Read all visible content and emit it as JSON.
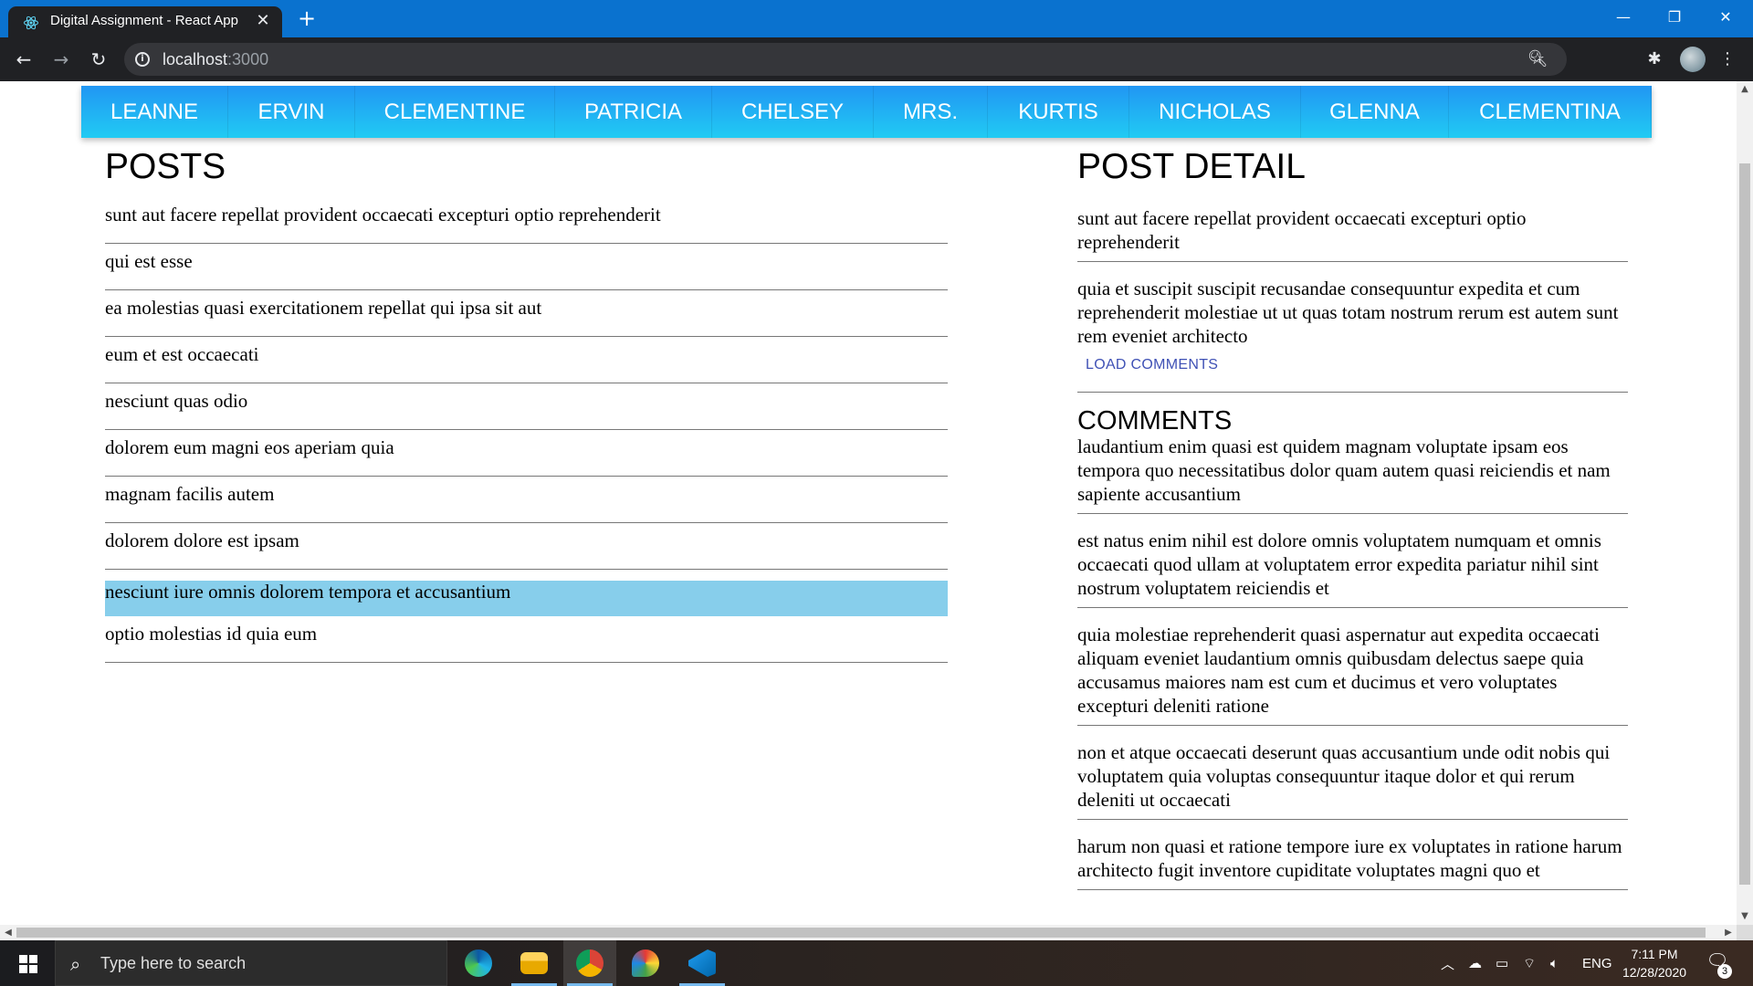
{
  "browser": {
    "tab_title": "Digital Assignment - React App",
    "tab_close": "✕",
    "new_tab": "+",
    "url_host": "localhost",
    "url_port": ":3000",
    "window_controls": {
      "minimize": "—",
      "restore": "❐",
      "close": "✕"
    }
  },
  "nav": {
    "items": [
      "LEANNE",
      "ERVIN",
      "CLEMENTINE",
      "PATRICIA",
      "CHELSEY",
      "MRS.",
      "KURTIS",
      "NICHOLAS",
      "GLENNA",
      "CLEMENTINA"
    ],
    "colors": {
      "gradient_start": "#2196f3",
      "gradient_end": "#21cbf3"
    }
  },
  "posts": {
    "title": "POSTS",
    "items": [
      "sunt aut facere repellat provident occaecati excepturi optio reprehenderit",
      "qui est esse",
      "ea molestias quasi exercitationem repellat qui ipsa sit aut",
      "eum et est occaecati",
      "nesciunt quas odio",
      "dolorem eum magni eos aperiam quia",
      "magnam facilis autem",
      "dolorem dolore est ipsam",
      "nesciunt iure omnis dolorem tempora et accusantium",
      "optio molestias id quia eum"
    ],
    "selected_index": 8,
    "selected_color": "#87ceeb"
  },
  "detail": {
    "title": "POST DETAIL",
    "post_title": "sunt aut facere repellat provident occaecati excepturi optio reprehenderit",
    "post_body": "quia et suscipit suscipit recusandae consequuntur expedita et cum reprehenderit molestiae ut ut quas totam nostrum rerum est autem sunt rem eveniet architecto",
    "load_comments_label": "LOAD COMMENTS",
    "comments_title": "COMMENTS",
    "comments": [
      "laudantium enim quasi est quidem magnam voluptate ipsam eos tempora quo necessitatibus dolor quam autem quasi reiciendis et nam sapiente accusantium",
      "est natus enim nihil est dolore omnis voluptatem numquam et omnis occaecati quod ullam at voluptatem error expedita pariatur nihil sint nostrum voluptatem reiciendis et",
      "quia molestiae reprehenderit quasi aspernatur aut expedita occaecati aliquam eveniet laudantium omnis quibusdam delectus saepe quia accusamus maiores nam est cum et ducimus et vero voluptates excepturi deleniti ratione",
      "non et atque occaecati deserunt quas accusantium unde odit nobis qui voluptatem quia voluptas consequuntur itaque dolor et qui rerum deleniti ut occaecati",
      "harum non quasi et ratione tempore iure ex voluptates in ratione harum architecto fugit inventore cupiditate voluptates magni quo et"
    ]
  },
  "taskbar": {
    "search_placeholder": "Type here to search",
    "language": "ENG",
    "time": "7:11 PM",
    "date": "12/28/2020",
    "notification_count": "3"
  }
}
